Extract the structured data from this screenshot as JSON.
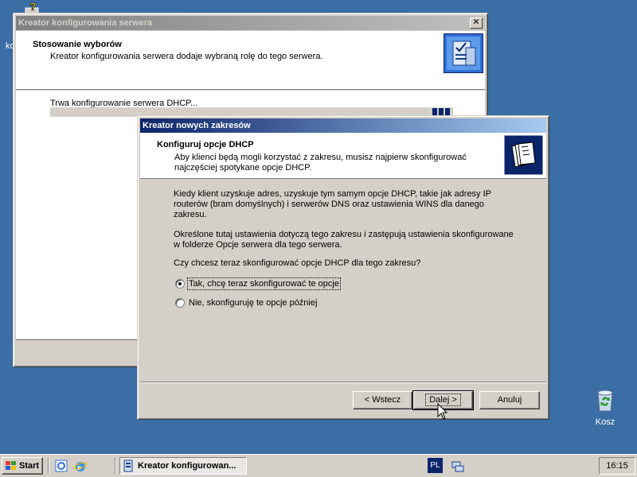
{
  "back_window": {
    "title": "Kreator konfigurowania serwera",
    "header_title": "Stosowanie wyborów",
    "header_subtitle": "Kreator konfigurowania serwera dodaje wybraną rolę do tego serwera.",
    "status_text": "Trwa konfigurowanie serwera DHCP...",
    "close_glyph": "✕"
  },
  "dialog": {
    "title": "Kreator nowych zakresów",
    "header_title": "Konfiguruj opcje DHCP",
    "header_subtitle_line1": "Aby klienci będą mogli korzystać z zakresu, musisz najpierw skonfigurować",
    "header_subtitle_line2": "najczęściej spotykane opcje DHCP.",
    "para1_line1": "Kiedy klient uzyskuje adres, uzyskuje tym samym opcje DHCP, takie jak adresy IP",
    "para1_line2": "routerów (bram domyślnych) i serwerów DNS oraz ustawienia WINS dla danego",
    "para1_line3": "zakresu.",
    "para2_line1": "Określone tutaj ustawienia dotyczą tego zakresu i zastępują ustawienia skonfigurowane",
    "para2_line2": "w folderze Opcje serwera dla tego serwera.",
    "question": "Czy chcesz teraz skonfigurować opcje DHCP dla tego zakresu?",
    "radio_yes": "Tak, chcę teraz skonfigurować te opcje",
    "radio_no": "Nie, skonfiguruję te opcje później",
    "selected_option": "yes",
    "btn_back": "< Wstecz",
    "btn_next": "Dalej >",
    "btn_cancel": "Anuluj"
  },
  "desktop": {
    "recycle_bin_label": "Kosz",
    "left_edge_text": "ko"
  },
  "taskbar": {
    "start_label": "Start",
    "task_label": "Kreator konfigurowan...",
    "language": "PL",
    "clock": "16:15"
  },
  "colors": {
    "desktop": "#3a6ea5",
    "active_title_start": "#0a246a",
    "active_title_end": "#a6caf0",
    "inactive_title_start": "#808080",
    "face": "#d4d0c8"
  }
}
